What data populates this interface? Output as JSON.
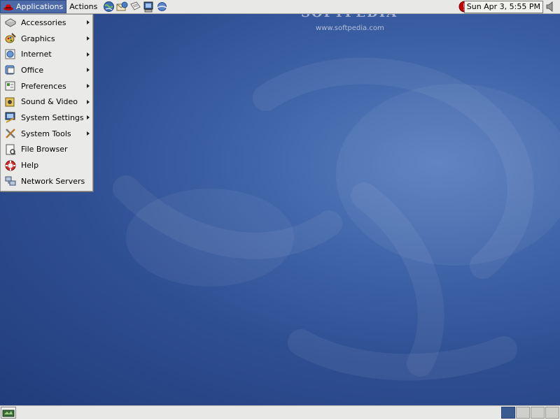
{
  "top_panel": {
    "applications_label": "Applications",
    "actions_label": "Actions",
    "launchers": [
      "web-browser-icon",
      "email-icon",
      "text-editor-icon",
      "terminal-icon",
      "network-icon"
    ],
    "clock": "Sun Apr  3,  5:55 PM"
  },
  "watermark": {
    "logo": "SOFTPEDIA",
    "url": "www.softpedia.com"
  },
  "app_menu": {
    "items": [
      {
        "label": "Accessories",
        "icon": "accessories-icon",
        "submenu": true
      },
      {
        "label": "Graphics",
        "icon": "graphics-icon",
        "submenu": true
      },
      {
        "label": "Internet",
        "icon": "internet-icon",
        "submenu": true
      },
      {
        "label": "Office",
        "icon": "office-icon",
        "submenu": true
      },
      {
        "label": "Preferences",
        "icon": "preferences-icon",
        "submenu": true
      },
      {
        "label": "Sound & Video",
        "icon": "sound-video-icon",
        "submenu": true
      },
      {
        "label": "System Settings",
        "icon": "system-settings-icon",
        "submenu": true
      },
      {
        "label": "System Tools",
        "icon": "system-tools-icon",
        "submenu": true
      },
      {
        "label": "File Browser",
        "icon": "file-browser-icon",
        "submenu": false
      },
      {
        "label": "Help",
        "icon": "help-icon",
        "submenu": false
      },
      {
        "label": "Network Servers",
        "icon": "network-servers-icon",
        "submenu": false
      }
    ]
  },
  "bottom_panel": {
    "workspaces": 4,
    "current_workspace": 1
  },
  "colors": {
    "desktop": "#2f4f93",
    "panel": "#e8e8e6",
    "menu_highlight": "#4b6aa7"
  }
}
